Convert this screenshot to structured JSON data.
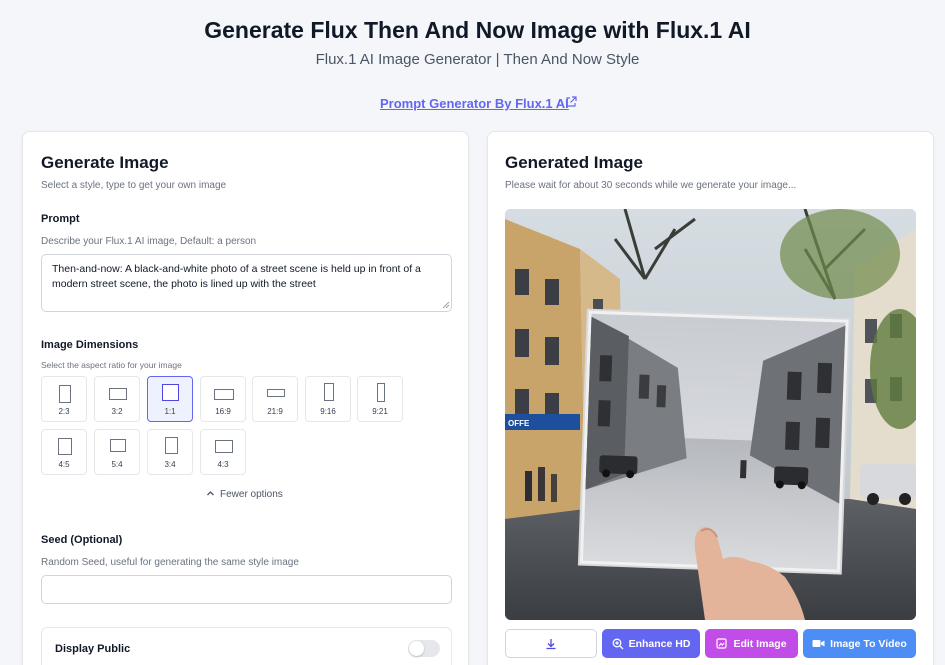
{
  "header": {
    "title": "Generate Flux Then And Now Image with Flux.1 AI",
    "subtitle": "Flux.1 AI Image Generator | Then And Now Style",
    "link_label": "Prompt Generator By Flux.1 AI"
  },
  "left": {
    "title": "Generate Image",
    "subtitle": "Select a style, type to get your own image",
    "prompt": {
      "label": "Prompt",
      "hint": "Describe your Flux.1 AI image, Default: a person",
      "value": "Then-and-now: A black-and-white photo of a street scene is held up in front of a modern street scene, the photo is lined up with the street"
    },
    "dimensions": {
      "label": "Image Dimensions",
      "hint": "Select the aspect ratio for your image",
      "selected": "1:1",
      "ratios": [
        "2:3",
        "3:2",
        "1:1",
        "16:9",
        "21:9",
        "9:16",
        "9:21",
        "4:5",
        "5:4",
        "3:4",
        "4:3"
      ],
      "fewer_label": "Fewer options"
    },
    "seed": {
      "label": "Seed (Optional)",
      "hint": "Random Seed, useful for generating the same style image",
      "value": ""
    },
    "public": {
      "label": "Display Public",
      "enabled": false
    }
  },
  "right": {
    "title": "Generated Image",
    "subtitle": "Please wait for about 30 seconds while we generate your image...",
    "buttons": {
      "enhance": "Enhance HD",
      "edit": "Edit Image",
      "video": "Image To Video"
    },
    "image_sign_text": "OFFE"
  },
  "colors": {
    "accent": "#6366f1",
    "edit": "#c14ce8",
    "video": "#4c8df6"
  }
}
